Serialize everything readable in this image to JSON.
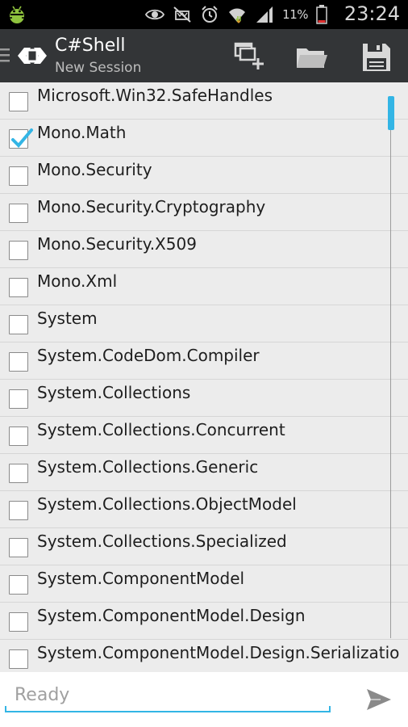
{
  "status_bar": {
    "battery_percent": "11%",
    "time": "23:24",
    "icons": [
      "android-debug-icon",
      "eye-icon",
      "no-sound-icon",
      "alarm-icon",
      "wifi-icon",
      "signal-icon",
      "battery-icon"
    ]
  },
  "action_bar": {
    "title": "C#Shell",
    "subtitle": "New Session",
    "actions": [
      "new-tab-icon",
      "folder-icon",
      "save-icon"
    ]
  },
  "list": {
    "items": [
      {
        "label": "Microsoft.Win32.SafeHandles",
        "checked": false
      },
      {
        "label": "Mono.Math",
        "checked": true
      },
      {
        "label": "Mono.Security",
        "checked": false
      },
      {
        "label": "Mono.Security.Cryptography",
        "checked": false
      },
      {
        "label": "Mono.Security.X509",
        "checked": false
      },
      {
        "label": "Mono.Xml",
        "checked": false
      },
      {
        "label": "System",
        "checked": false
      },
      {
        "label": "System.CodeDom.Compiler",
        "checked": false
      },
      {
        "label": "System.Collections",
        "checked": false
      },
      {
        "label": "System.Collections.Concurrent",
        "checked": false
      },
      {
        "label": "System.Collections.Generic",
        "checked": false
      },
      {
        "label": "System.Collections.ObjectModel",
        "checked": false
      },
      {
        "label": "System.Collections.Specialized",
        "checked": false
      },
      {
        "label": "System.ComponentModel",
        "checked": false
      },
      {
        "label": "System.ComponentModel.Design",
        "checked": false
      },
      {
        "label": "System.ComponentModel.Design.Serializatio",
        "checked": false
      }
    ]
  },
  "input": {
    "placeholder": "Ready",
    "value": ""
  },
  "colors": {
    "accent": "#33b5e5",
    "action_bar": "#333537",
    "list_bg": "#ececec"
  }
}
